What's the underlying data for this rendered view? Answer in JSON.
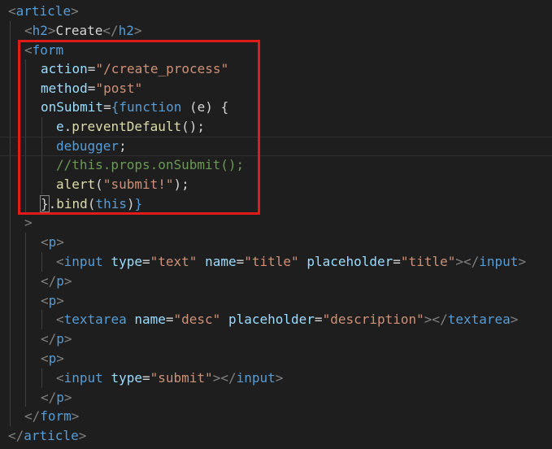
{
  "editor": {
    "lines": [
      {
        "tokens": [
          {
            "c": "bracket",
            "t": "<"
          },
          {
            "c": "tag",
            "t": "article"
          },
          {
            "c": "bracket",
            "t": ">"
          }
        ]
      },
      {
        "tokens": [
          {
            "c": "bracket",
            "t": "<"
          },
          {
            "c": "tag",
            "t": "h2"
          },
          {
            "c": "bracket",
            "t": ">"
          },
          {
            "c": "plain",
            "t": "Create"
          },
          {
            "c": "bracket",
            "t": "</"
          },
          {
            "c": "tag",
            "t": "h2"
          },
          {
            "c": "bracket",
            "t": ">"
          }
        ]
      },
      {
        "tokens": [
          {
            "c": "bracket",
            "t": "<"
          },
          {
            "c": "tag",
            "t": "form"
          }
        ]
      },
      {
        "tokens": [
          {
            "c": "attr",
            "t": "action"
          },
          {
            "c": "plain",
            "t": "="
          },
          {
            "c": "str",
            "t": "\"/create_process\""
          }
        ]
      },
      {
        "tokens": [
          {
            "c": "attr",
            "t": "method"
          },
          {
            "c": "plain",
            "t": "="
          },
          {
            "c": "str",
            "t": "\"post\""
          }
        ]
      },
      {
        "tokens": [
          {
            "c": "attr",
            "t": "onSubmit"
          },
          {
            "c": "plain",
            "t": "="
          },
          {
            "c": "kw",
            "t": "{"
          },
          {
            "c": "kw",
            "t": "function"
          },
          {
            "c": "plain",
            "t": " (e) {"
          }
        ]
      },
      {
        "tokens": [
          {
            "c": "attr",
            "t": "e"
          },
          {
            "c": "plain",
            "t": "."
          },
          {
            "c": "fn",
            "t": "preventDefault"
          },
          {
            "c": "plain",
            "t": "();"
          }
        ]
      },
      {
        "tokens": [
          {
            "c": "kw",
            "t": "debugger"
          },
          {
            "c": "plain",
            "t": ";"
          }
        ]
      },
      {
        "tokens": [
          {
            "c": "comment",
            "t": "//this.props.onSubmit();"
          }
        ]
      },
      {
        "tokens": [
          {
            "c": "fn",
            "t": "alert"
          },
          {
            "c": "plain",
            "t": "("
          },
          {
            "c": "str",
            "t": "\"submit!\""
          },
          {
            "c": "plain",
            "t": ");"
          }
        ]
      },
      {
        "tokens": [
          {
            "c": "brace-match",
            "t": "}"
          },
          {
            "c": "plain",
            "t": "."
          },
          {
            "c": "fn",
            "t": "bind"
          },
          {
            "c": "plain",
            "t": "("
          },
          {
            "c": "kw",
            "t": "this"
          },
          {
            "c": "plain",
            "t": ")"
          },
          {
            "c": "kw",
            "t": "}"
          }
        ]
      },
      {
        "tokens": [
          {
            "c": "bracket",
            "t": ">"
          }
        ]
      },
      {
        "tokens": [
          {
            "c": "bracket",
            "t": "<"
          },
          {
            "c": "tag",
            "t": "p"
          },
          {
            "c": "bracket",
            "t": ">"
          }
        ]
      },
      {
        "tokens": [
          {
            "c": "bracket",
            "t": "<"
          },
          {
            "c": "tag",
            "t": "input"
          },
          {
            "c": "plain",
            "t": " "
          },
          {
            "c": "attr",
            "t": "type"
          },
          {
            "c": "plain",
            "t": "="
          },
          {
            "c": "str",
            "t": "\"text\""
          },
          {
            "c": "plain",
            "t": " "
          },
          {
            "c": "attr",
            "t": "name"
          },
          {
            "c": "plain",
            "t": "="
          },
          {
            "c": "str",
            "t": "\"title\""
          },
          {
            "c": "plain",
            "t": " "
          },
          {
            "c": "attr",
            "t": "placeholder"
          },
          {
            "c": "plain",
            "t": "="
          },
          {
            "c": "str",
            "t": "\"title\""
          },
          {
            "c": "bracket",
            "t": "></"
          },
          {
            "c": "tag",
            "t": "input"
          },
          {
            "c": "bracket",
            "t": ">"
          }
        ]
      },
      {
        "tokens": [
          {
            "c": "bracket",
            "t": "</"
          },
          {
            "c": "tag",
            "t": "p"
          },
          {
            "c": "bracket",
            "t": ">"
          }
        ]
      },
      {
        "tokens": [
          {
            "c": "bracket",
            "t": "<"
          },
          {
            "c": "tag",
            "t": "p"
          },
          {
            "c": "bracket",
            "t": ">"
          }
        ]
      },
      {
        "tokens": [
          {
            "c": "bracket",
            "t": "<"
          },
          {
            "c": "tag",
            "t": "textarea"
          },
          {
            "c": "plain",
            "t": " "
          },
          {
            "c": "attr",
            "t": "name"
          },
          {
            "c": "plain",
            "t": "="
          },
          {
            "c": "str",
            "t": "\"desc\""
          },
          {
            "c": "plain",
            "t": " "
          },
          {
            "c": "attr",
            "t": "placeholder"
          },
          {
            "c": "plain",
            "t": "="
          },
          {
            "c": "str",
            "t": "\"description\""
          },
          {
            "c": "bracket",
            "t": "></"
          },
          {
            "c": "tag",
            "t": "textarea"
          },
          {
            "c": "bracket",
            "t": ">"
          }
        ]
      },
      {
        "tokens": [
          {
            "c": "bracket",
            "t": "</"
          },
          {
            "c": "tag",
            "t": "p"
          },
          {
            "c": "bracket",
            "t": ">"
          }
        ]
      },
      {
        "tokens": [
          {
            "c": "bracket",
            "t": "<"
          },
          {
            "c": "tag",
            "t": "p"
          },
          {
            "c": "bracket",
            "t": ">"
          }
        ]
      },
      {
        "tokens": [
          {
            "c": "bracket",
            "t": "<"
          },
          {
            "c": "tag",
            "t": "input"
          },
          {
            "c": "plain",
            "t": " "
          },
          {
            "c": "attr",
            "t": "type"
          },
          {
            "c": "plain",
            "t": "="
          },
          {
            "c": "str",
            "t": "\"submit\""
          },
          {
            "c": "bracket",
            "t": "></"
          },
          {
            "c": "tag",
            "t": "input"
          },
          {
            "c": "bracket",
            "t": ">"
          }
        ]
      },
      {
        "tokens": [
          {
            "c": "bracket",
            "t": "</"
          },
          {
            "c": "tag",
            "t": "p"
          },
          {
            "c": "bracket",
            "t": ">"
          }
        ]
      },
      {
        "tokens": [
          {
            "c": "bracket",
            "t": "</"
          },
          {
            "c": "tag",
            "t": "form"
          },
          {
            "c": "bracket",
            "t": ">"
          }
        ]
      },
      {
        "tokens": [
          {
            "c": "bracket",
            "t": "</"
          },
          {
            "c": "tag",
            "t": "article"
          },
          {
            "c": "bracket",
            "t": ">"
          }
        ]
      }
    ]
  },
  "colors": {
    "background": "#1e1e1e",
    "highlight_border": "#e11a1a"
  }
}
